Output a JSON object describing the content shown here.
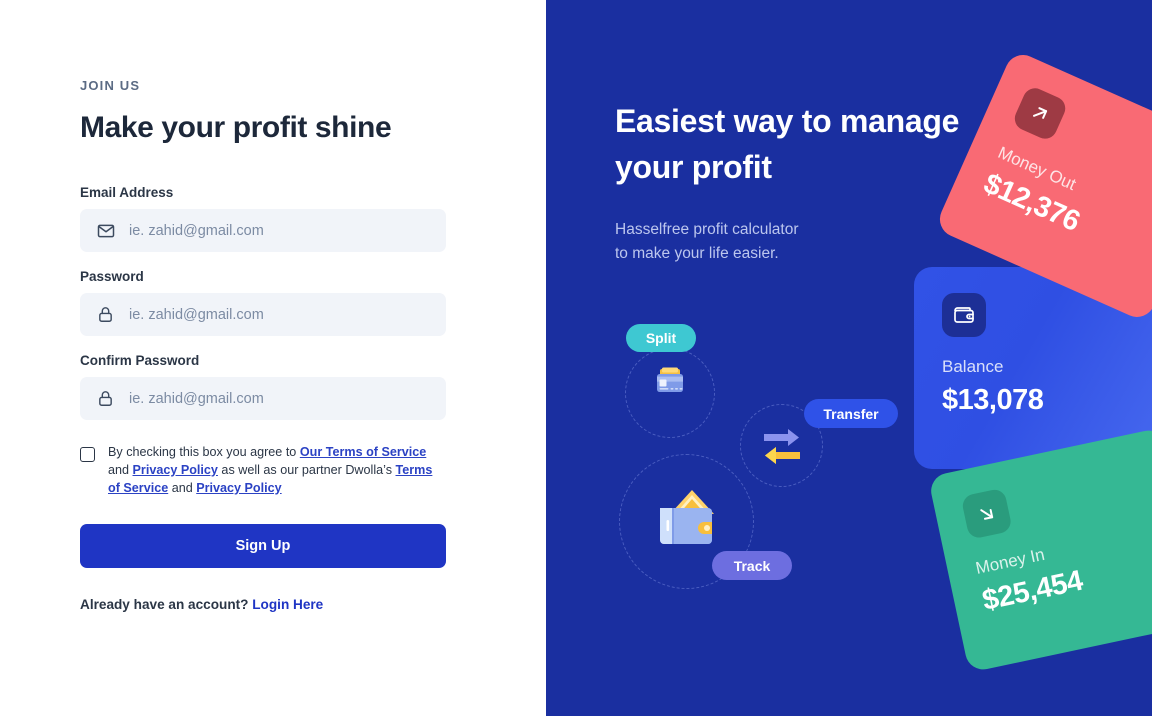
{
  "left": {
    "eyebrow": "JOIN US",
    "headline": "Make your profit shine",
    "fields": [
      {
        "label": "Email Address",
        "placeholder": "ie. zahid@gmail.com",
        "icon": "envelope-icon",
        "value": ""
      },
      {
        "label": "Password",
        "placeholder": "ie. zahid@gmail.com",
        "icon": "lock-icon",
        "value": ""
      },
      {
        "label": "Confirm Password",
        "placeholder": "ie. zahid@gmail.com",
        "icon": "lock-icon",
        "value": ""
      }
    ],
    "terms": {
      "part1": "By checking this box you agree to ",
      "link1": "Our Terms of Service",
      "part2": " and ",
      "link2": "Privacy Policy",
      "part3": " as well as our partner Dwolla’s ",
      "link3": "Terms of Service",
      "part4": " and ",
      "link4": "Privacy Policy",
      "checked": false
    },
    "signup_label": "Sign Up",
    "login_prompt": "Already have an account? ",
    "login_link": "Login Here"
  },
  "right": {
    "hero_title_line1": "Easiest way to manage",
    "hero_title_line2": "your profit",
    "hero_sub_line1": "Hasselfree profit calculator",
    "hero_sub_line2": "to make your life easier.",
    "pills": [
      {
        "label": "Split",
        "icon": "credit-card-icon"
      },
      {
        "label": "Transfer",
        "icon": "exchange-arrows-icon"
      },
      {
        "label": "Track",
        "icon": "wallet-cash-icon"
      }
    ],
    "cards": [
      {
        "id": "money-out",
        "label": "Money Out",
        "value": "$12,376",
        "icon": "arrow-up-right-icon",
        "color": "#f96a74"
      },
      {
        "id": "balance",
        "label": "Balance",
        "value": "$13,078",
        "icon": "wallet-icon",
        "color": "#3152e6"
      },
      {
        "id": "money-in",
        "label": "Money In",
        "value": "$25,454",
        "icon": "arrow-down-right-icon",
        "color": "#35b894"
      }
    ]
  },
  "colors": {
    "brand_blue": "#1f35c4",
    "panel_blue": "#1a2fa0",
    "link_blue": "#2b42c4",
    "input_bg": "#f1f4f9",
    "pink": "#f96a74",
    "green": "#35b894",
    "teal": "#3ec8d2",
    "purple": "#6d6ee0"
  }
}
